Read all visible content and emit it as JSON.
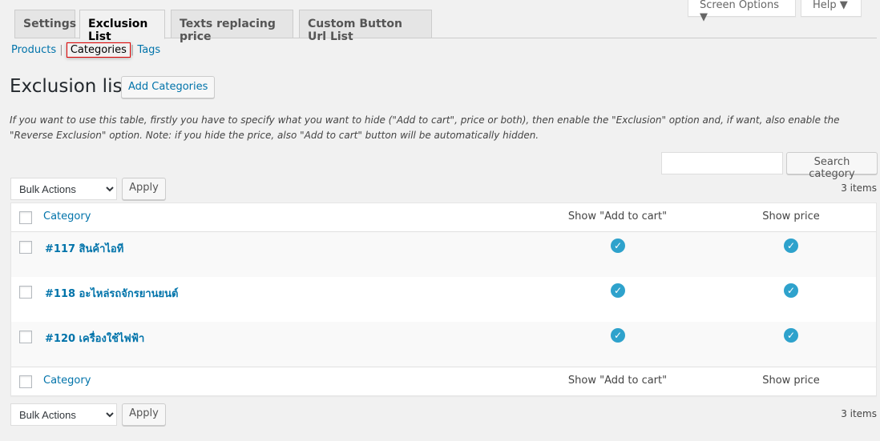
{
  "top": {
    "screen_options": "Screen Options ▼",
    "help": "Help ▼"
  },
  "tabs": [
    "Settings",
    "Exclusion List",
    "Texts replacing price",
    "Custom Button Url List"
  ],
  "subnav": {
    "products": "Products",
    "categories": "Categories",
    "tags": "Tags",
    "sep": "|"
  },
  "page": {
    "title": "Exclusion list",
    "add_button": "Add Categories",
    "description": "If you want to use this table, firstly you have to specify what you want to hide (\"Add to cart\", price or both), then enable the \"Exclusion\" option and, if want, also enable the \"Reverse Exclusion\" option. Note: if you hide the price, also \"Add to cart\" button will be automatically hidden."
  },
  "search": {
    "value": "",
    "button": "Search category"
  },
  "bulk": {
    "selected": "Bulk Actions",
    "apply": "Apply",
    "count": "3 items"
  },
  "table": {
    "columns": [
      "Category",
      "Show \"Add to cart\"",
      "Show price"
    ],
    "rows": [
      {
        "name": "#117 สินค้าไอที",
        "add_to_cart": true,
        "price": true
      },
      {
        "name": "#118 อะไหล่รถจักรยานยนต์",
        "add_to_cart": true,
        "price": true
      },
      {
        "name": "#120 เครื่องใช้ไฟฟ้า",
        "add_to_cart": true,
        "price": true
      }
    ]
  },
  "colors": {
    "link": "#0073aa",
    "check": "#2ea2cc",
    "highlight": "#e00000"
  },
  "icons": {
    "check": "check-circle-icon"
  }
}
